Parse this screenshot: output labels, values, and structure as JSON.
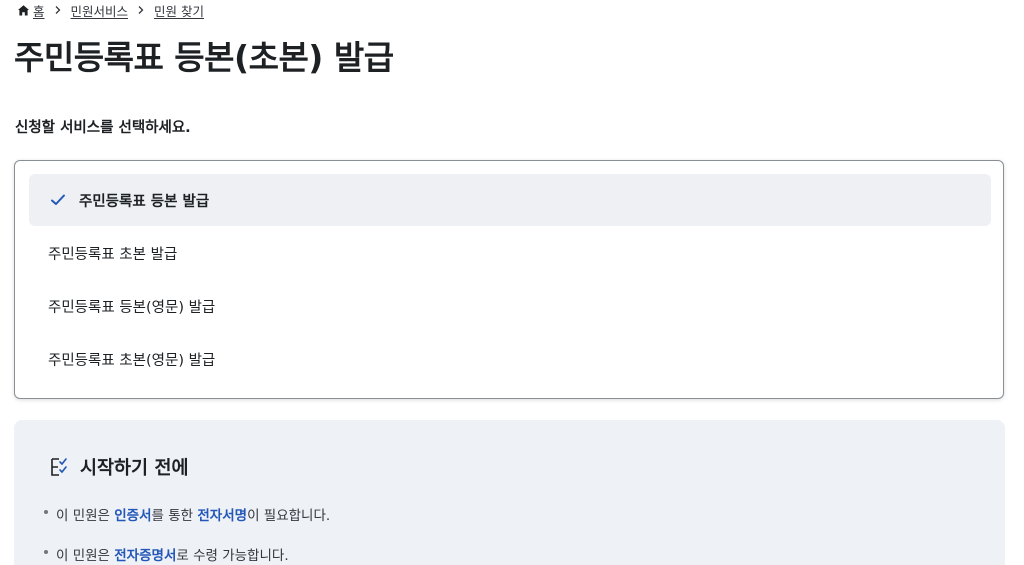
{
  "breadcrumb": {
    "home": "홈",
    "items": [
      "민원서비스",
      "민원 찾기"
    ]
  },
  "page_title": "주민등록표 등본(초본) 발급",
  "instruction": "신청할 서비스를 선택하세요.",
  "options": [
    {
      "label": "주민등록표 등본 발급",
      "selected": true
    },
    {
      "label": "주민등록표 초본 발급",
      "selected": false
    },
    {
      "label": "주민등록표 등본(영문) 발급",
      "selected": false
    },
    {
      "label": "주민등록표 초본(영문) 발급",
      "selected": false
    }
  ],
  "before_start": {
    "heading": "시작하기 전에",
    "item1": {
      "p1": "이 민원은 ",
      "h1": "인증서",
      "p2": "를 통한 ",
      "h2": "전자서명",
      "p3": "이 필요합니다."
    },
    "item2": {
      "p1": "이 민원은 ",
      "h1": "전자증명서",
      "p2": "로 수령 가능합니다."
    }
  },
  "colors": {
    "accent": "#2257b8",
    "selected_bg": "#eef0f4",
    "panel_bg": "#eef1f6",
    "text": "#1e2124"
  },
  "icons": [
    "home-icon",
    "chevron-right-icon",
    "check-icon",
    "checklist-icon"
  ]
}
